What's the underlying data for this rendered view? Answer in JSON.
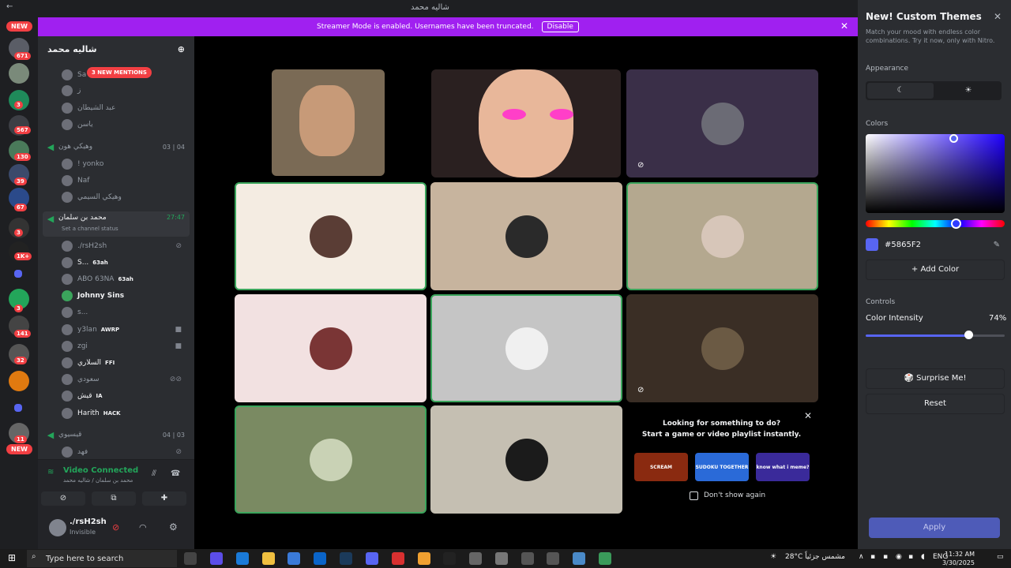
{
  "window": {
    "title": "شالیه محمد"
  },
  "banner": {
    "text": "Streamer Mode is enabled. Usernames have been truncated.",
    "disable": "Disable"
  },
  "servers": {
    "top_pill": "NEW",
    "bottom_pill": "NEW",
    "badges": [
      "671",
      "3",
      "567",
      "130",
      "39",
      "67",
      "3",
      "1K+",
      "3",
      "141",
      "32",
      "11"
    ]
  },
  "sidebar": {
    "guild_name": "شالیه محمد",
    "mentions": "3 NEW MENTIONS",
    "top_users": [
      "Sa",
      "ز",
      "عبد الشیطان",
      "ياسن"
    ],
    "channels": [
      {
        "name": "وهيكي هون",
        "counts_a": "03",
        "counts_b": "04",
        "users": [
          "! yonko",
          "Naf",
          "وهيكي السيمي"
        ]
      },
      {
        "name": "محمد بن سلمان",
        "time": "27:47",
        "status": "Set a channel status",
        "users": [
          {
            "name": "./rsH2sh",
            "tag": ""
          },
          {
            "name": "S...",
            "tag": "63ah"
          },
          {
            "name": "ABO 63NA",
            "tag": "63ah"
          },
          {
            "name": "Johnny Sins",
            "tag": ""
          },
          {
            "name": "s...",
            "tag": ""
          },
          {
            "name": "y3lan",
            "tag": "AWRP"
          },
          {
            "name": "zgi",
            "tag": ""
          },
          {
            "name": "السلاري",
            "tag": "FFI"
          },
          {
            "name": "سعودي",
            "tag": ""
          },
          {
            "name": "قیش",
            "tag": "IA"
          },
          {
            "name": "Harith",
            "tag": "HACK"
          }
        ]
      },
      {
        "name": "قيسيوي",
        "counts_a": "04",
        "counts_b": "03",
        "users": [
          "ﻓﻬﺪ"
        ]
      }
    ]
  },
  "voice_panel": {
    "status": "Video Connected",
    "subtitle": "محمد بن سلمان / شالیه محمد"
  },
  "me": {
    "name": "./rsH2sh",
    "status": "Invisible"
  },
  "promo": {
    "line1": "Looking for something to do?",
    "line2": "Start a game or video playlist instantly.",
    "cards": [
      "SCREAM",
      "SUDOKU TOGETHER",
      "know what i meme?"
    ],
    "dont_show": "Don't show again"
  },
  "themes": {
    "title": "New! Custom Themes",
    "desc": "Match your mood with endless color combinations. Try it now, only with Nitro.",
    "appearance": "Appearance",
    "colors": "Colors",
    "hex": "#5865F2",
    "add_color": "+ Add Color",
    "controls": "Controls",
    "intensity_label": "Color Intensity",
    "intensity_value": "74%",
    "surprise": "Surprise Me!",
    "reset": "Reset",
    "apply": "Apply",
    "intensity": 0.74
  },
  "taskbar": {
    "search": "Type here to search",
    "weather": "28°C مشمس جزئياً",
    "lang": "ENG",
    "time": "11:32 AM",
    "date": "3/30/2025"
  }
}
